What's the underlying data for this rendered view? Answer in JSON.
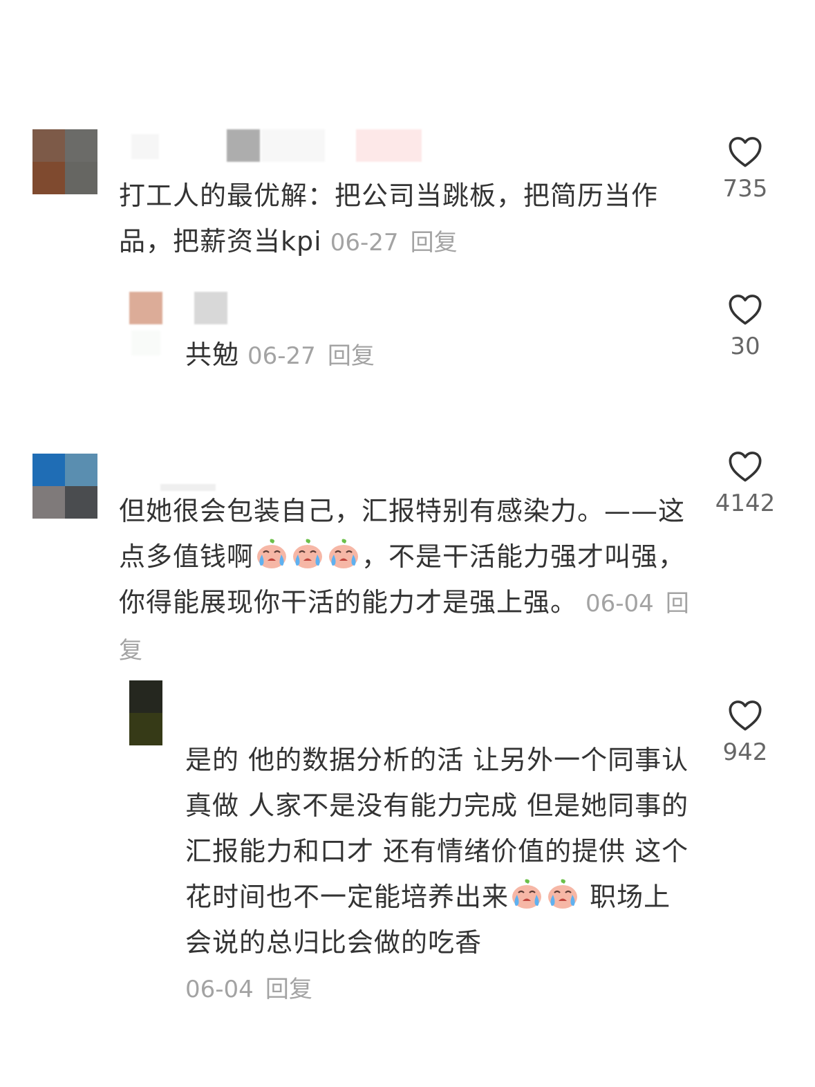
{
  "comments": [
    {
      "text": "打工人的最优解：把公司当跳板，把简历当作品，把薪资当kpi",
      "date": "06-27",
      "reply_label": "回复",
      "likes": "735",
      "reply": {
        "text": "共勉",
        "date": "06-27",
        "reply_label": "回复",
        "likes": "30"
      }
    },
    {
      "text_a": "但她很会包装自己，汇报特别有感染力。——这点多值钱啊",
      "text_b": "，不是干活能力强才叫强，你得能展现你干活的能力才是强上强。",
      "date": "06-04",
      "reply_label": "回复",
      "likes": "4142",
      "reply": {
        "text_a": "是的 他的数据分析的活 让另外一个同事认真做 人家不是没有能力完成 但是她同事的汇报能力和口才 还有情绪价值的提供 这个花时间也不一定能培养出来",
        "text_b": " 职场上 会说的总归比会做的吃香",
        "date": "06-04",
        "reply_label": "回复",
        "likes": "942"
      }
    }
  ],
  "icons": {
    "like": "heart-outline-icon",
    "emoji": "crying-face-emoji-icon"
  },
  "colors": {
    "text": "#333333",
    "meta": "#a3a3a3",
    "count": "#666666"
  }
}
